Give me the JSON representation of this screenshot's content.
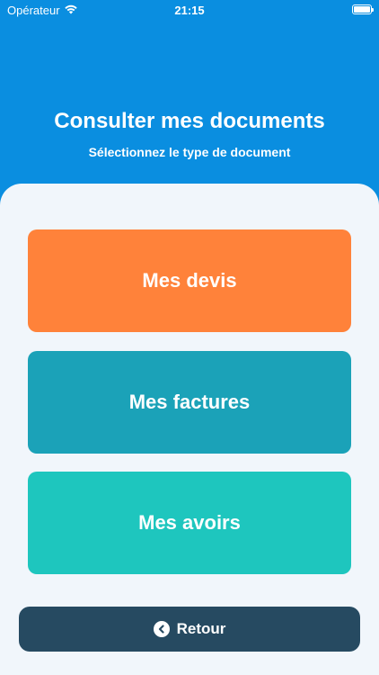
{
  "status_bar": {
    "carrier": "Opérateur",
    "time": "21:15",
    "wifi_icon": "wifi-icon",
    "battery_icon": "battery-icon"
  },
  "header": {
    "title": "Consulter mes documents",
    "subtitle": "Sélectionnez le type de document"
  },
  "options": [
    {
      "label": "Mes devis",
      "color": "#ff823a"
    },
    {
      "label": "Mes factures",
      "color": "#1ba2b8"
    },
    {
      "label": "Mes avoirs",
      "color": "#1ec6be"
    }
  ],
  "back_button": {
    "label": "Retour",
    "icon": "chevron-left-circle-icon",
    "color": "#264a61"
  },
  "colors": {
    "header_bg": "#0a8ee0",
    "panel_bg": "#f1f6fb"
  }
}
